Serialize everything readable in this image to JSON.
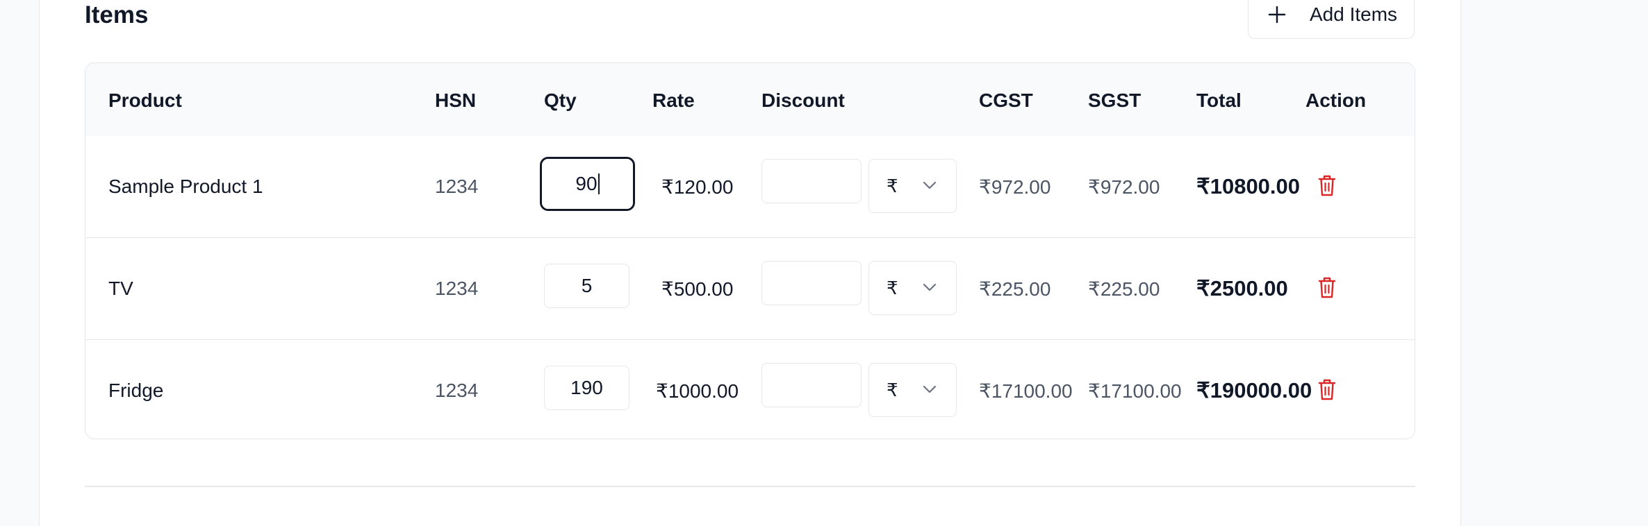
{
  "section": {
    "title": "Items",
    "add_button_label": "Add Items"
  },
  "table": {
    "headers": {
      "product": "Product",
      "hsn": "HSN",
      "qty": "Qty",
      "rate": "Rate",
      "discount": "Discount",
      "cgst": "CGST",
      "sgst": "SGST",
      "total": "Total",
      "action": "Action"
    },
    "rows": [
      {
        "product": "Sample Product 1",
        "hsn": "1234",
        "qty": "90",
        "rate": "₹120.00",
        "discount": "",
        "discount_type": "₹",
        "cgst": "₹972.00",
        "sgst": "₹972.00",
        "total": "₹10800.00"
      },
      {
        "product": "TV",
        "hsn": "1234",
        "qty": "5",
        "rate": "₹500.00",
        "discount": "",
        "discount_type": "₹",
        "cgst": "₹225.00",
        "sgst": "₹225.00",
        "total": "₹2500.00"
      },
      {
        "product": "Fridge",
        "hsn": "1234",
        "qty": "190",
        "rate": "₹1000.00",
        "discount": "",
        "discount_type": "₹",
        "cgst": "₹17100.00",
        "sgst": "₹17100.00",
        "total": "₹190000.00"
      }
    ]
  },
  "colors": {
    "text": "#111827",
    "muted": "#4b5563",
    "border": "#e5e7eb",
    "header_bg": "#f9fafb",
    "danger": "#dc2626"
  },
  "icons": {
    "add": "plus-icon",
    "select": "chevron-down-icon",
    "delete": "trash-icon"
  }
}
